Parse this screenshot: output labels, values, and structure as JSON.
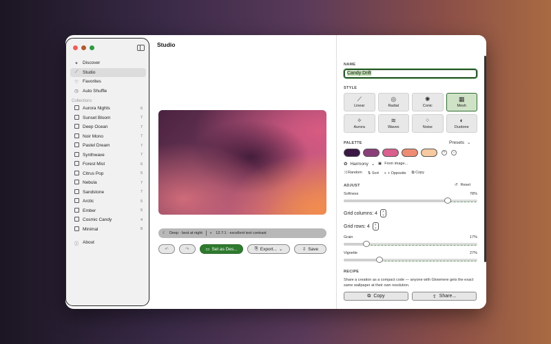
{
  "sidebar": {
    "items": [
      {
        "label": "Discover",
        "icon": "sparkle-wand-icon"
      },
      {
        "label": "Studio",
        "icon": "magic-wand-icon"
      },
      {
        "label": "Favorites",
        "icon": "heart-icon"
      },
      {
        "label": "Auto Shuffle",
        "icon": "clock-icon"
      }
    ],
    "collections_heading": "Collections",
    "collections": [
      {
        "label": "Aurora Nights",
        "count": "6"
      },
      {
        "label": "Sunset Bloom",
        "count": "7"
      },
      {
        "label": "Deep Ocean",
        "count": "7"
      },
      {
        "label": "Noir Mono",
        "count": "7"
      },
      {
        "label": "Pastel Dream",
        "count": "7"
      },
      {
        "label": "Synthwave",
        "count": "7"
      },
      {
        "label": "Forest Mist",
        "count": "6"
      },
      {
        "label": "Citrus Pop",
        "count": "5"
      },
      {
        "label": "Nebula",
        "count": "7"
      },
      {
        "label": "Sandstone",
        "count": "7"
      },
      {
        "label": "Arctic",
        "count": "5"
      },
      {
        "label": "Ember",
        "count": "5"
      },
      {
        "label": "Cosmic Candy",
        "count": "4"
      },
      {
        "label": "Minimal",
        "count": "8"
      }
    ],
    "about": "About"
  },
  "studio": {
    "title": "Studio",
    "info_tone": "Deep · best at night",
    "info_contrast": "12.7:1 · excellent text contrast",
    "set_button": "Set as Des...",
    "export_button": "Export...",
    "save_button": "Save"
  },
  "panel": {
    "name_label": "NAME",
    "name_value": "Candy Drift",
    "style_label": "STYLE",
    "styles": [
      {
        "label": "Linear",
        "glyph": "⟋",
        "selected": false
      },
      {
        "label": "Radial",
        "glyph": "◎",
        "selected": false
      },
      {
        "label": "Conic",
        "glyph": "✺",
        "selected": false
      },
      {
        "label": "Mesh",
        "glyph": "▦",
        "selected": true
      },
      {
        "label": "Aurora",
        "glyph": "✧",
        "selected": false
      },
      {
        "label": "Waves",
        "glyph": "≋",
        "selected": false
      },
      {
        "label": "Noise",
        "glyph": "⁘",
        "selected": false
      },
      {
        "label": "Duotone",
        "glyph": "◐",
        "selected": false
      }
    ],
    "palette_label": "PALETTE",
    "presets": "Presets",
    "swatches": [
      "#3a1745",
      "#8a3f78",
      "#d9608f",
      "#ef8d74",
      "#f6c9a0"
    ],
    "harmony": "Harmony",
    "from_image": "From image...",
    "random": "Random",
    "sort": "Sort",
    "opposite": "+ Opposite",
    "copy_small": "Copy",
    "adjust_label": "ADJUST",
    "reset": "Reset",
    "softness_label": "Softness",
    "softness_value": "78%",
    "softness": 0.78,
    "grid_columns": "Grid columns: 4",
    "grid_rows": "Grid rows: 4",
    "grain_label": "Grain",
    "grain_value": "17%",
    "grain": 0.17,
    "vignette_label": "Vignette",
    "vignette_value": "27%",
    "vignette": 0.27,
    "recipe_label": "RECIPE",
    "recipe_text": "Share a creation as a compact code — anyone with Glowmere gets the exact same wallpaper at their own resolution.",
    "copy_button": "Copy",
    "share_button": "Share..."
  }
}
